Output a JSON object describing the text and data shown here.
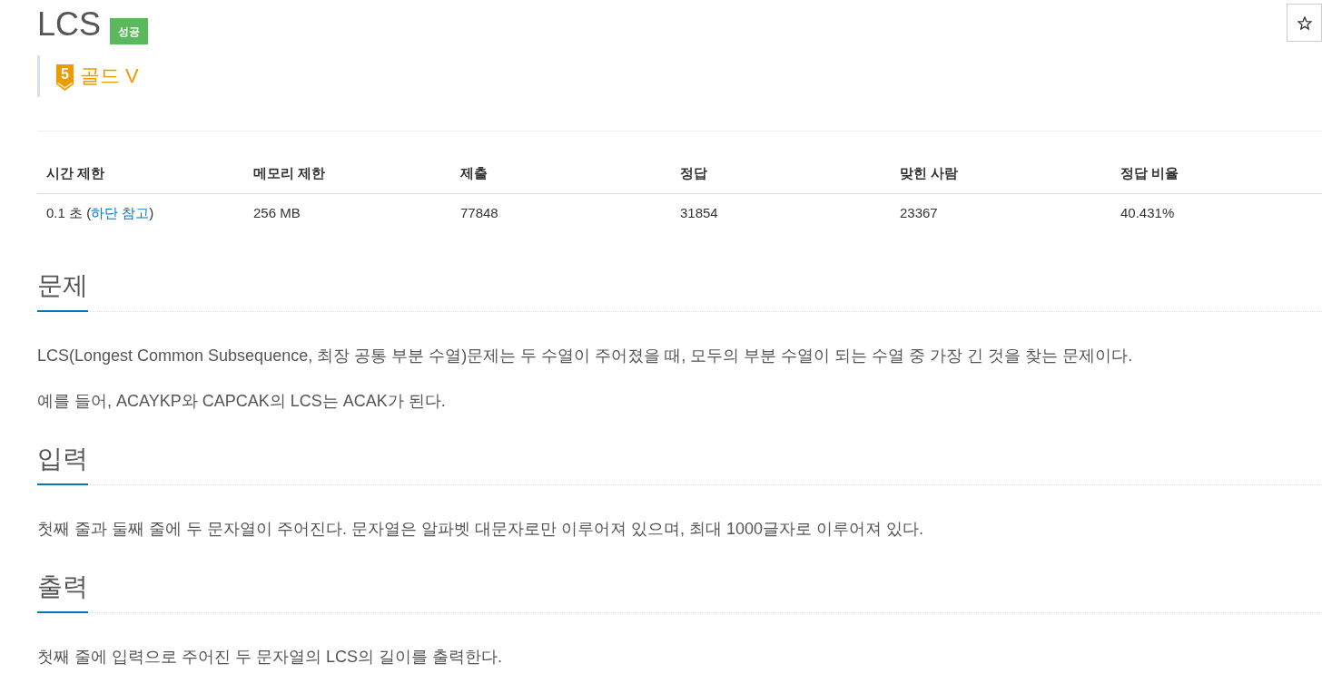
{
  "problem": {
    "title": "LCS",
    "result_badge": "성공",
    "starred": false
  },
  "tier": {
    "number": "5",
    "name": "골드 V"
  },
  "info_table": {
    "columns": [
      "시간 제한",
      "메모리 제한",
      "제출",
      "정답",
      "맞힌 사람",
      "정답 비율"
    ],
    "rows": [
      [
        {
          "text": "0.1 초 (",
          "link": "하단 참고",
          "suffix": ")"
        },
        {
          "text": "256 MB"
        },
        {
          "text": "77848"
        },
        {
          "text": "31854"
        },
        {
          "text": "23367"
        },
        {
          "text": "40.431%"
        }
      ]
    ]
  },
  "sections": [
    {
      "heading": "문제",
      "paragraphs": [
        "LCS(Longest Common Subsequence, 최장 공통 부분 수열)문제는 두 수열이 주어졌을 때, 모두의 부분 수열이 되는 수열 중 가장 긴 것을 찾는 문제이다.",
        "예를 들어, ACAYKP와 CAPCAK의 LCS는 ACAK가 된다."
      ]
    },
    {
      "heading": "입력",
      "paragraphs": [
        "첫째 줄과 둘째 줄에 두 문자열이 주어진다. 문자열은 알파벳 대문자로만 이루어져 있으며, 최대 1000글자로 이루어져 있다."
      ]
    },
    {
      "heading": "출력",
      "paragraphs": [
        "첫째 줄에 입력으로 주어진 두 문자열의 LCS의 길이를 출력한다."
      ]
    }
  ]
}
